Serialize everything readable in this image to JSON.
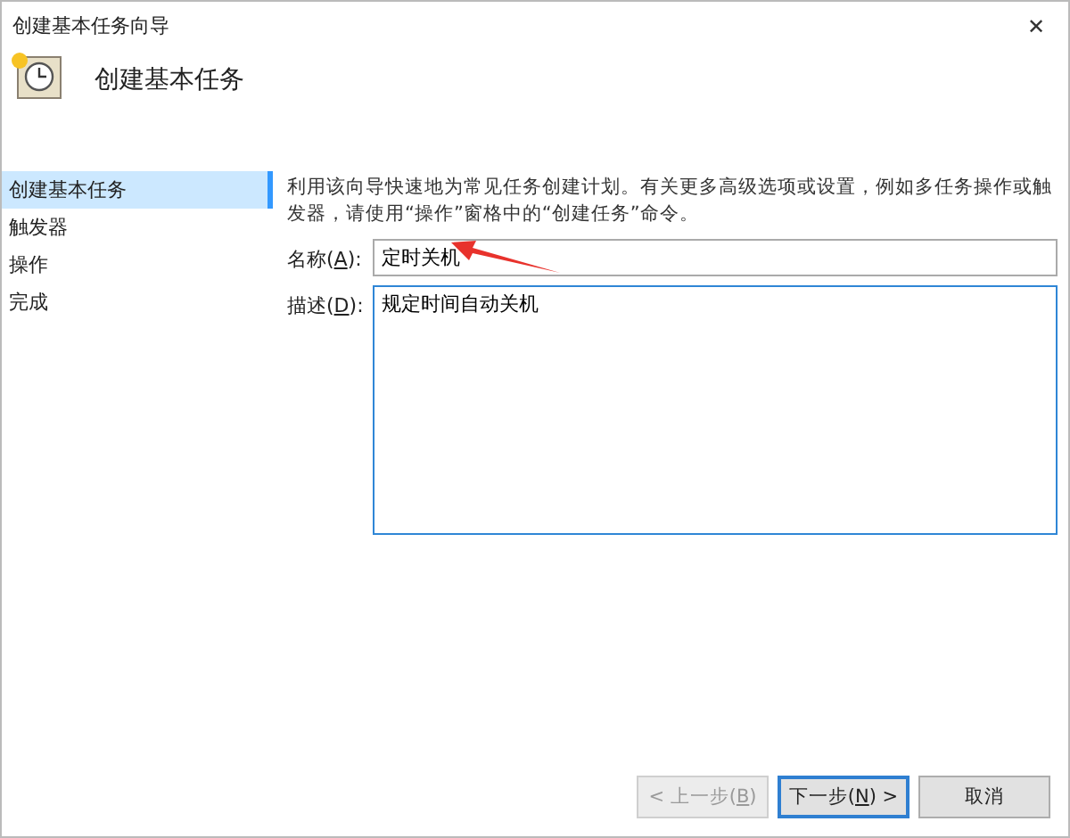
{
  "window": {
    "title": "创建基本任务向导",
    "close": "✕"
  },
  "header": {
    "title": "创建基本任务"
  },
  "sidebar": {
    "items": [
      {
        "label": "创建基本任务",
        "selected": true
      },
      {
        "label": "触发器",
        "selected": false
      },
      {
        "label": "操作",
        "selected": false
      },
      {
        "label": "完成",
        "selected": false
      }
    ]
  },
  "intro": "利用该向导快速地为常见任务创建计划。有关更多高级选项或设置，例如多任务操作或触发器，请使用“操作”窗格中的“创建任务”命令。",
  "fields": [
    {
      "kind": "input",
      "label": "名称(",
      "access_key": "A",
      "label_end": "):",
      "value": "定时关机"
    },
    {
      "kind": "textarea",
      "label": "描述(",
      "access_key": "D",
      "label_end": "):",
      "value": "规定时间自动关机"
    }
  ],
  "buttons": [
    {
      "prefix": "< 上一步(",
      "access_key": "B",
      "suffix": ")",
      "disabled": true,
      "default": false
    },
    {
      "prefix": "下一步(",
      "access_key": "N",
      "suffix": ") >",
      "disabled": false,
      "default": true
    },
    {
      "prefix": "取消",
      "disabled": false,
      "default": false
    }
  ]
}
